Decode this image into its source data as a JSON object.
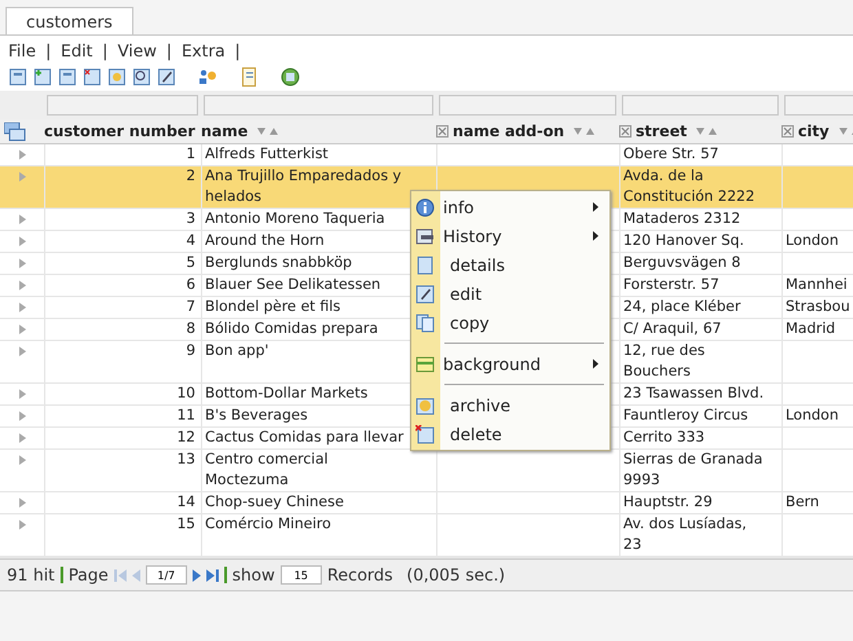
{
  "tabs": [
    {
      "label": "customers",
      "selected": true
    }
  ],
  "menu_bar": [
    {
      "label": "File",
      "separator": "|"
    },
    {
      "label": "Edit",
      "separator": "|"
    },
    {
      "label": "View",
      "separator": "|"
    },
    {
      "label": "Extra",
      "separator": "|"
    }
  ],
  "table": {
    "columns": [
      "customer number",
      "name",
      "name add-on",
      "street",
      "city"
    ],
    "rows": [
      {
        "customer_number": "1",
        "name": "Alfreds Futterkist",
        "street": "Obere Str. 57",
        "selected": false
      },
      {
        "customer_number": "2",
        "name": "Ana Trujillo Emparedados y helados",
        "street": "Avda. de la Constitución 2222",
        "selected": true
      },
      {
        "customer_number": "3",
        "name": "Antonio Moreno Taqueria",
        "street": "Mataderos 2312",
        "selected": false
      },
      {
        "customer_number": "4",
        "name": "Around the Horn",
        "street": "120 Hanover Sq.",
        "city": "London",
        "selected": false
      },
      {
        "customer_number": "5",
        "name": "Berglunds snabbköp",
        "street": "Berguvsvägen 8",
        "selected": false
      },
      {
        "customer_number": "6",
        "name": "Blauer See Delikatessen",
        "street": "Forsterstr. 57",
        "city": "Mannhei",
        "selected": false
      },
      {
        "customer_number": "7",
        "name": "Blondel père et fils",
        "street": "24, place Kléber",
        "city": "Strasbou",
        "selected": false
      },
      {
        "customer_number": "8",
        "name": "Bólido Comidas prepara",
        "street": "C/ Araquil, 67",
        "city": "Madrid",
        "selected": false
      },
      {
        "customer_number": "9",
        "name": "Bon app'",
        "street": "12, rue des Bouchers",
        "selected": false
      },
      {
        "customer_number": "10",
        "name": "Bottom-Dollar Markets",
        "street": "23 Tsawassen Blvd.",
        "selected": false
      },
      {
        "customer_number": "11",
        "name": "B's Beverages",
        "street": "Fauntleroy Circus",
        "city": "London",
        "selected": false
      },
      {
        "customer_number": "12",
        "name": "Cactus Comidas para llevar",
        "street": "Cerrito 333",
        "selected": false
      },
      {
        "customer_number": "13",
        "name": "Centro comercial Moctezuma",
        "street": "Sierras de Granada 9993",
        "selected": false
      },
      {
        "customer_number": "14",
        "name": "Chop-suey Chinese",
        "street": "Hauptstr. 29",
        "city": "Bern",
        "selected": false
      },
      {
        "customer_number": "15",
        "name": "Comércio Mineiro",
        "street": "Av. dos Lusíadas, 23",
        "selected": false
      }
    ]
  },
  "context_menu": [
    {
      "kind": "item",
      "label": "info",
      "submenu": true
    },
    {
      "kind": "item",
      "label": "History",
      "submenu": true
    },
    {
      "kind": "item",
      "label": "details",
      "submenu": false
    },
    {
      "kind": "item",
      "label": "edit",
      "submenu": false
    },
    {
      "kind": "item",
      "label": "copy",
      "submenu": false
    },
    {
      "kind": "separator"
    },
    {
      "kind": "item",
      "label": "background",
      "submenu": true
    },
    {
      "kind": "separator"
    },
    {
      "kind": "item",
      "label": "archive",
      "submenu": false
    },
    {
      "kind": "item",
      "label": "delete",
      "submenu": false
    }
  ],
  "status_bar": {
    "hits": "91 hit",
    "page_label": "Page",
    "page": "1/7",
    "show_label": "show",
    "page_size": "15",
    "records_label": "Records",
    "time": "(0,005 sec.)"
  }
}
